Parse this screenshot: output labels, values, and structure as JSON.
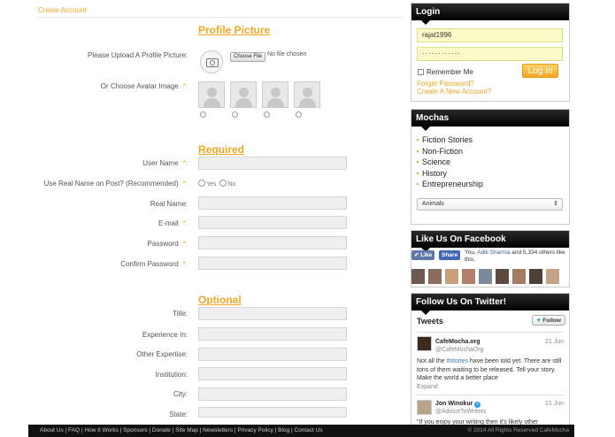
{
  "breadcrumb": "Create Account",
  "sections": {
    "profile_picture": "Profile Picture",
    "required": "Required",
    "optional": "Optional"
  },
  "labels": {
    "upload": "Please Upload A Profile Picture:",
    "avatar": "Or Choose Avatar Image",
    "username": "User Name",
    "use_real_name": "Use Real Name on Post? (Recommended)",
    "real_name": "Real Name:",
    "email": "E-mail",
    "password": "Password",
    "confirm_password": "Confirm Password",
    "title": "Title:",
    "experience_in": "Experience In:",
    "other_expertise": "Other Expertise:",
    "institution": "Institution:",
    "city": "City:",
    "state": "State:"
  },
  "required_mark": "*:",
  "file": {
    "button": "Choose File",
    "status": "No file chosen"
  },
  "real_name_options": {
    "yes": "Yes",
    "no": "No"
  },
  "login": {
    "title": "Login",
    "username_value": "rajat1996",
    "password_value": "············",
    "remember_label": "Remember Me",
    "button": "Log In",
    "forgot": "Forget Password?",
    "create": "Create A New Account?"
  },
  "mochas": {
    "title": "Mochas",
    "items": [
      "Fiction Stories",
      "Non-Fiction",
      "Science",
      "History",
      "Entrepreneurship"
    ],
    "select_value": "Animals"
  },
  "facebook": {
    "title": "Like Us On Facebook",
    "like": "Like",
    "share": "Share",
    "text_you": "You,",
    "text_name": "Aditi Sharma",
    "text_rest": "and 5,334 others like this."
  },
  "twitter": {
    "title": "Follow Us On Twitter!",
    "tweets_label": "Tweets",
    "follow_button": "Follow",
    "tweets": [
      {
        "name": "CafeMocha.org",
        "handle": "@CafeMochaOrg",
        "date": "21 Jun",
        "text_before": "Not all the ",
        "hashtag": "#stories",
        "text_after": " have been told yet. There are still tons of them waiting to be released. Tell your story. Make the world a better place",
        "expand": "Expand"
      },
      {
        "name": "Jon Winokur",
        "handle": "@AdviceToWriters",
        "date": "21 Jun",
        "text_before": "\"If you enjoy your writing then it's likely other",
        "hashtag": "",
        "text_after": ""
      }
    ]
  },
  "footer": {
    "links": "About Us  |  FAQ  |  How It Works  |  Sponsors  |  Donate  |  Site Map  |  Newsletters  |  Privacy Policy  |  Blog  |  Contact Us",
    "copyright": "© 2014 All Rights Reserved CafeMocha"
  },
  "colors": {
    "accent": "#f5a623",
    "header_bg": "#000000",
    "input_bg": "#efefef",
    "login_field_bg": "#fbfbc7",
    "facebook": "#3b5998"
  }
}
